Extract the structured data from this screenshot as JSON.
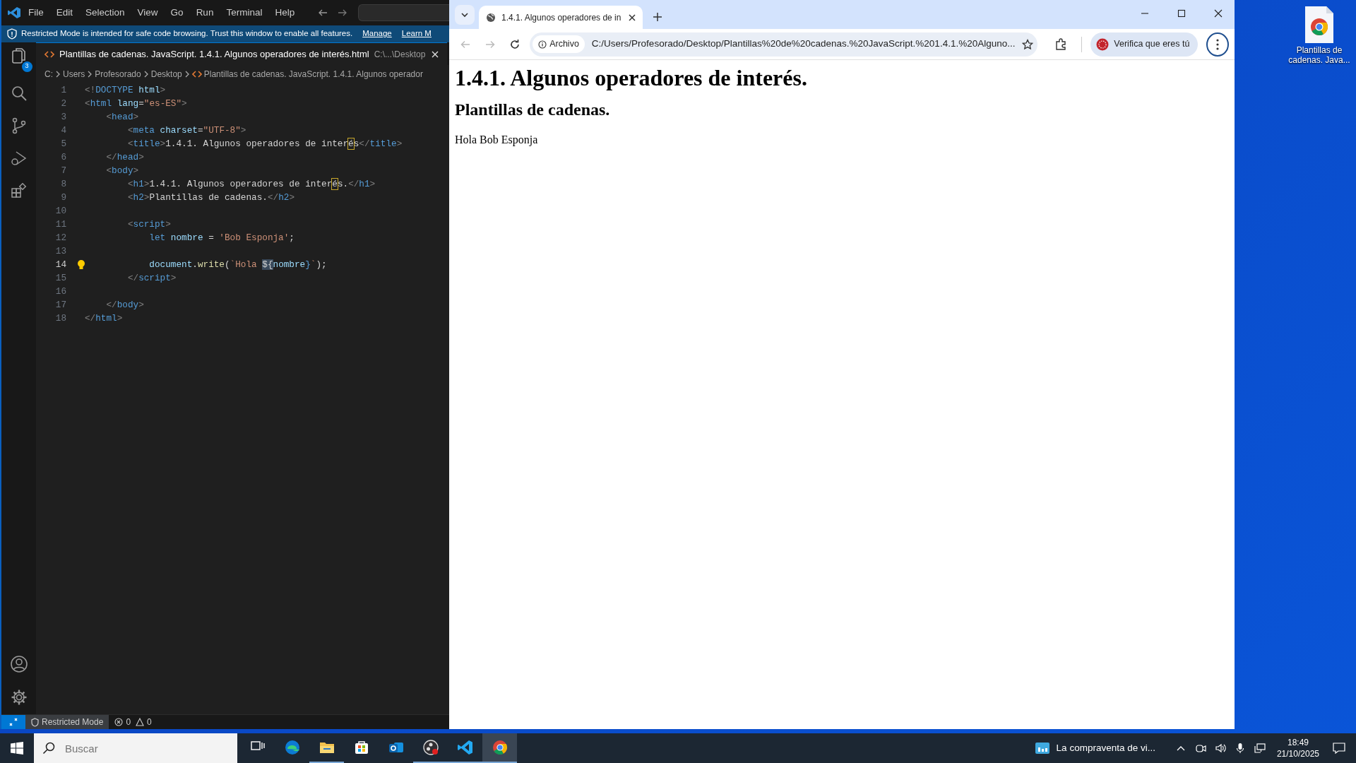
{
  "vscode": {
    "menu": [
      "File",
      "Edit",
      "Selection",
      "View",
      "Go",
      "Run",
      "Terminal",
      "Help"
    ],
    "banner": {
      "text": "Restricted Mode is intended for safe code browsing. Trust this window to enable all features.",
      "links": [
        "Manage",
        "Learn M"
      ]
    },
    "explorer_badge": "3",
    "tabs": [
      {
        "label": "Plantillas de cadenas. JavaScript. 1.4.1. Algunos operadores de interés.html",
        "description": "C:\\...\\Desktop",
        "selected": true
      }
    ],
    "breadcrumb": [
      "C:",
      "Users",
      "Profesorado",
      "Desktop",
      "Plantillas de cadenas. JavaScript. 1.4.1. Algunos operador"
    ],
    "code": [
      {
        "number": "1",
        "current": false,
        "tokens": [
          {
            "kind": "punct",
            "text": "<!"
          },
          {
            "kind": "tag",
            "text": "DOCTYPE"
          },
          {
            "kind": "attr",
            "text": " html"
          },
          {
            "kind": "punct",
            "text": ">"
          }
        ]
      },
      {
        "number": "2",
        "current": false,
        "tokens": [
          {
            "kind": "punct",
            "text": "<"
          },
          {
            "kind": "tag",
            "text": "html"
          },
          {
            "kind": "attr",
            "text": " lang"
          },
          {
            "kind": "text",
            "text": "="
          },
          {
            "kind": "string",
            "text": "\"es-ES\""
          },
          {
            "kind": "punct",
            "text": ">"
          }
        ]
      },
      {
        "number": "3",
        "current": false,
        "tokens": [
          {
            "kind": "punct",
            "text": "    <"
          },
          {
            "kind": "tag",
            "text": "head"
          },
          {
            "kind": "punct",
            "text": ">"
          }
        ]
      },
      {
        "number": "4",
        "current": false,
        "tokens": [
          {
            "kind": "punct",
            "text": "        <"
          },
          {
            "kind": "tag",
            "text": "meta"
          },
          {
            "kind": "attr",
            "text": " charset"
          },
          {
            "kind": "text",
            "text": "="
          },
          {
            "kind": "string",
            "text": "\"UTF-8\""
          },
          {
            "kind": "punct",
            "text": ">"
          }
        ]
      },
      {
        "number": "5",
        "current": false,
        "tokens": [
          {
            "kind": "punct",
            "text": "        <"
          },
          {
            "kind": "tag",
            "text": "title"
          },
          {
            "kind": "punct",
            "text": ">"
          },
          {
            "kind": "text",
            "text": "1.4.1. Algunos operadores de inter"
          },
          {
            "kind": "match",
            "text": "é"
          },
          {
            "kind": "text",
            "text": "s"
          },
          {
            "kind": "punct",
            "text": "</"
          },
          {
            "kind": "tag",
            "text": "title"
          },
          {
            "kind": "punct",
            "text": ">"
          }
        ]
      },
      {
        "number": "6",
        "current": false,
        "tokens": [
          {
            "kind": "punct",
            "text": "    </"
          },
          {
            "kind": "tag",
            "text": "head"
          },
          {
            "kind": "punct",
            "text": ">"
          }
        ]
      },
      {
        "number": "7",
        "current": false,
        "tokens": [
          {
            "kind": "punct",
            "text": "    <"
          },
          {
            "kind": "tag",
            "text": "body"
          },
          {
            "kind": "punct",
            "text": ">"
          }
        ]
      },
      {
        "number": "8",
        "current": false,
        "tokens": [
          {
            "kind": "punct",
            "text": "        <"
          },
          {
            "kind": "tag",
            "text": "h1"
          },
          {
            "kind": "punct",
            "text": ">"
          },
          {
            "kind": "text",
            "text": "1.4.1. Algunos operadores de inter"
          },
          {
            "kind": "match",
            "text": "é"
          },
          {
            "kind": "text",
            "text": "s."
          },
          {
            "kind": "punct",
            "text": "</"
          },
          {
            "kind": "tag",
            "text": "h1"
          },
          {
            "kind": "punct",
            "text": ">"
          }
        ]
      },
      {
        "number": "9",
        "current": false,
        "tokens": [
          {
            "kind": "punct",
            "text": "        <"
          },
          {
            "kind": "tag",
            "text": "h2"
          },
          {
            "kind": "punct",
            "text": ">"
          },
          {
            "kind": "text",
            "text": "Plantillas de cadenas."
          },
          {
            "kind": "punct",
            "text": "</"
          },
          {
            "kind": "tag",
            "text": "h2"
          },
          {
            "kind": "punct",
            "text": ">"
          }
        ]
      },
      {
        "number": "10",
        "current": false
      },
      {
        "number": "11",
        "current": false,
        "tokens": [
          {
            "kind": "punct",
            "text": "        <"
          },
          {
            "kind": "tag",
            "text": "script"
          },
          {
            "kind": "punct",
            "text": ">"
          }
        ]
      },
      {
        "number": "12",
        "current": false,
        "tokens": [
          {
            "kind": "keyword",
            "text": "            let"
          },
          {
            "kind": "var",
            "text": " nombre"
          },
          {
            "kind": "text",
            "text": " = "
          },
          {
            "kind": "string",
            "text": "'Bob Esponja'"
          },
          {
            "kind": "text",
            "text": ";"
          }
        ]
      },
      {
        "number": "13",
        "current": false
      },
      {
        "number": "14",
        "current": true,
        "tokens": [
          {
            "kind": "var",
            "text": "            document"
          },
          {
            "kind": "text",
            "text": "."
          },
          {
            "kind": "func",
            "text": "write"
          },
          {
            "kind": "text",
            "text": "("
          },
          {
            "kind": "string",
            "text": "`Hola "
          },
          {
            "kind": "highlight",
            "text": "${"
          },
          {
            "kind": "var",
            "text": "nombre"
          },
          {
            "kind": "keyword",
            "text": "}"
          },
          {
            "kind": "string",
            "text": "`"
          },
          {
            "kind": "text",
            "text": ");"
          }
        ]
      },
      {
        "number": "15",
        "current": false,
        "tokens": [
          {
            "kind": "punct",
            "text": "        </"
          },
          {
            "kind": "tag",
            "text": "script"
          },
          {
            "kind": "punct",
            "text": ">"
          }
        ]
      },
      {
        "number": "16",
        "current": false
      },
      {
        "number": "17",
        "current": false,
        "tokens": [
          {
            "kind": "punct",
            "text": "    </"
          },
          {
            "kind": "tag",
            "text": "body"
          },
          {
            "kind": "punct",
            "text": ">"
          }
        ]
      },
      {
        "number": "18",
        "current": false,
        "tokens": [
          {
            "kind": "punct",
            "text": "</"
          },
          {
            "kind": "tag",
            "text": "html"
          },
          {
            "kind": "punct",
            "text": ">"
          }
        ]
      }
    ],
    "status_bar": {
      "mode": "Restricted Mode",
      "errors": "0",
      "warnings": "0"
    }
  },
  "browser": {
    "tab": {
      "title": "1.4.1. Algunos operadores de in"
    },
    "address": {
      "chip": "Archivo",
      "url": "C:/Users/Profesorado/Desktop/Plantillas%20de%20cadenas.%20JavaScript.%201.4.1.%20Alguno..."
    },
    "profile": "Verifica que eres tú",
    "page": {
      "h1": "1.4.1. Algunos operadores de interés.",
      "h2": "Plantillas de cadenas.",
      "text": "Hola Bob Esponja"
    }
  },
  "desktop_icon": {
    "label": "Plantillas de cadenas. Java..."
  },
  "taskbar": {
    "search_placeholder": "Buscar",
    "news": "La compraventa de vi...",
    "time": "18:49",
    "date": "21/10/2025"
  }
}
